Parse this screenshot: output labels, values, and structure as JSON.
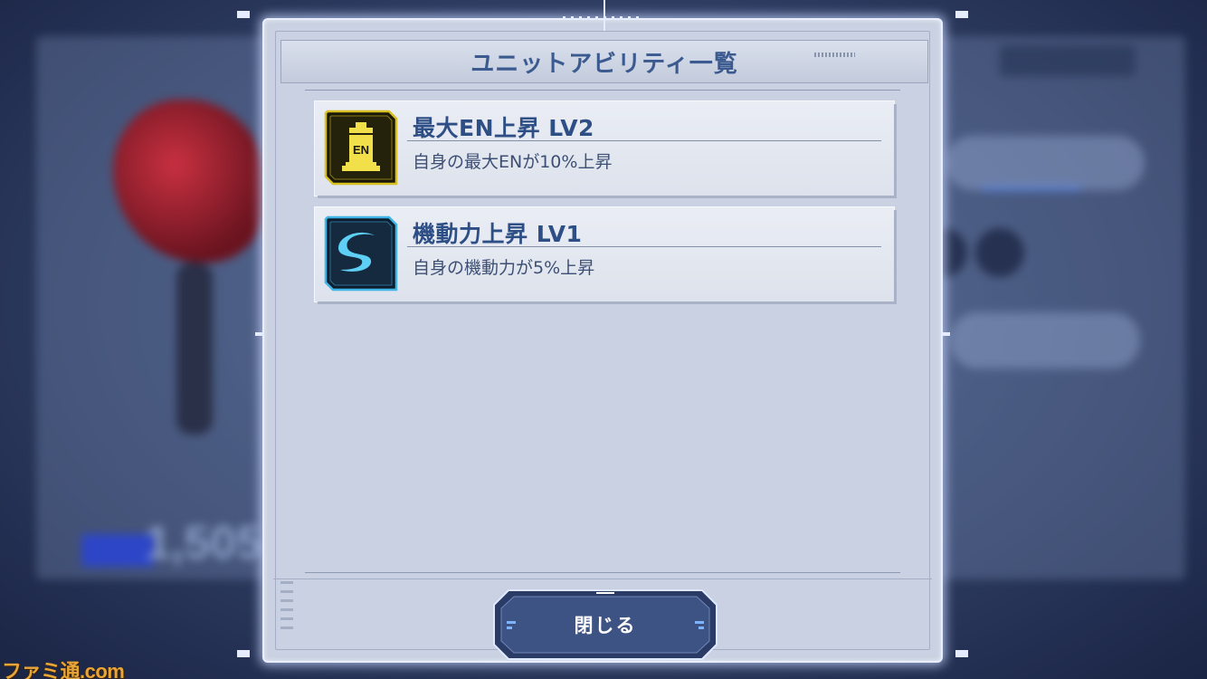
{
  "modal": {
    "title": "ユニットアビリティ一覧",
    "close_label": "閉じる"
  },
  "abilities": [
    {
      "name": "最大EN上昇 LV2",
      "description": "自身の最大ENが10%上昇",
      "icon": "en-battery-icon",
      "icon_label": "EN",
      "icon_color": "#d8c020"
    },
    {
      "name": "機動力上昇 LV1",
      "description": "自身の機動力が5%上昇",
      "icon": "mobility-swoosh-icon",
      "icon_color": "#3fb4e6"
    }
  ],
  "background": {
    "unit_value": "1,505"
  },
  "watermark": "ファミ通.com",
  "colors": {
    "title_text": "#3b5a8f",
    "ability_name": "#2e4f86",
    "modal_background": "#c9d1e2",
    "button_fill": "#3d5384"
  }
}
